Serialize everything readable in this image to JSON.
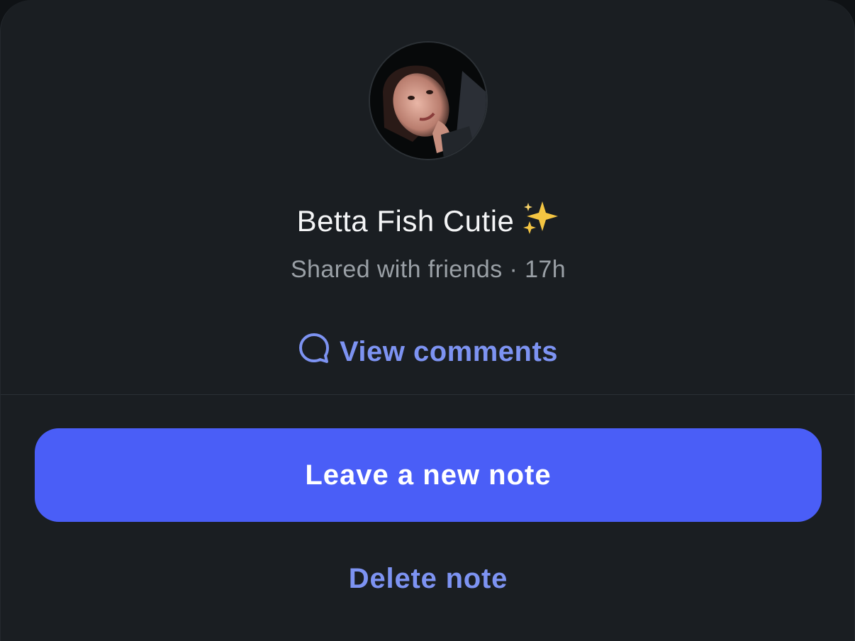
{
  "note": {
    "text": "Betta Fish Cutie",
    "emoji": "sparkles-icon",
    "audience": "Shared with friends",
    "separator": "·",
    "age": "17h"
  },
  "actions": {
    "view_comments_label": "View comments",
    "leave_new_note_label": "Leave a new note",
    "delete_note_label": "Delete note"
  },
  "colors": {
    "sheet_background": "#1a1e22",
    "accent_link": "#7d93f2",
    "primary_button": "#4a5ef7",
    "text_primary": "#f4f5f6",
    "text_secondary": "#9aa0a6"
  }
}
